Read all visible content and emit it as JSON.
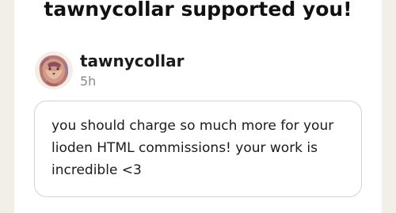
{
  "header": {
    "title": "tawnycollar supported you!"
  },
  "supporter": {
    "username": "tawnycollar",
    "timestamp": "5h",
    "avatar_icon": "lion-avatar-icon"
  },
  "message": {
    "text": "you should charge so much more for your lioden HTML commissions! your work is incredible <3"
  },
  "colors": {
    "page_background": "#f2efe9",
    "card_background": "#ffffff",
    "text_primary": "#1b1b1b",
    "text_muted": "#8a8a8a",
    "border": "#d3d3d3"
  }
}
